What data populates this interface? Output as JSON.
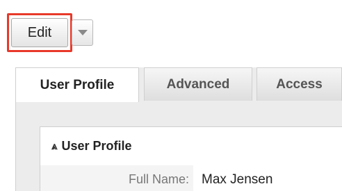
{
  "toolbar": {
    "edit_label": "Edit",
    "dropdown_icon": "caret-down",
    "highlight_color": "#e8392a"
  },
  "tabs": [
    {
      "label": "User Profile",
      "active": true
    },
    {
      "label": "Advanced",
      "active": false
    },
    {
      "label": "Access",
      "active": false
    }
  ],
  "panel": {
    "title": "User Profile",
    "toggle_icon": "collapse-up",
    "fields": [
      {
        "label": "Full Name:",
        "value": "Max Jensen"
      }
    ]
  }
}
